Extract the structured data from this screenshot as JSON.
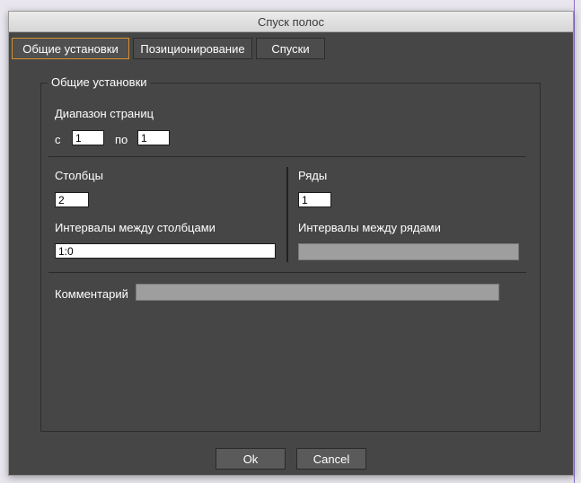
{
  "window": {
    "title": "Спуск полос"
  },
  "tabs": [
    {
      "label": "Общие установки",
      "active": true
    },
    {
      "label": "Позиционирование",
      "active": false
    },
    {
      "label": "Спуски",
      "active": false
    }
  ],
  "panel": {
    "legend": "Общие установки",
    "page_range": {
      "label": "Диапазон страниц",
      "from_label": "с",
      "from_value": "1",
      "to_label": "по",
      "to_value": "1"
    },
    "columns": {
      "label": "Столбцы",
      "value": "2",
      "gap_label": "Интервалы между столбцами",
      "gap_value": "1:0"
    },
    "rows": {
      "label": "Ряды",
      "value": "1",
      "gap_label": "Интервалы между рядами",
      "gap_value": ""
    },
    "comment": {
      "label": "Комментарий",
      "value": ""
    }
  },
  "buttons": {
    "ok": "Ok",
    "cancel": "Cancel"
  },
  "colors": {
    "dialog_bg": "#464646",
    "active_tab_border": "#d8902a",
    "disabled_field": "#9e9e9e"
  }
}
